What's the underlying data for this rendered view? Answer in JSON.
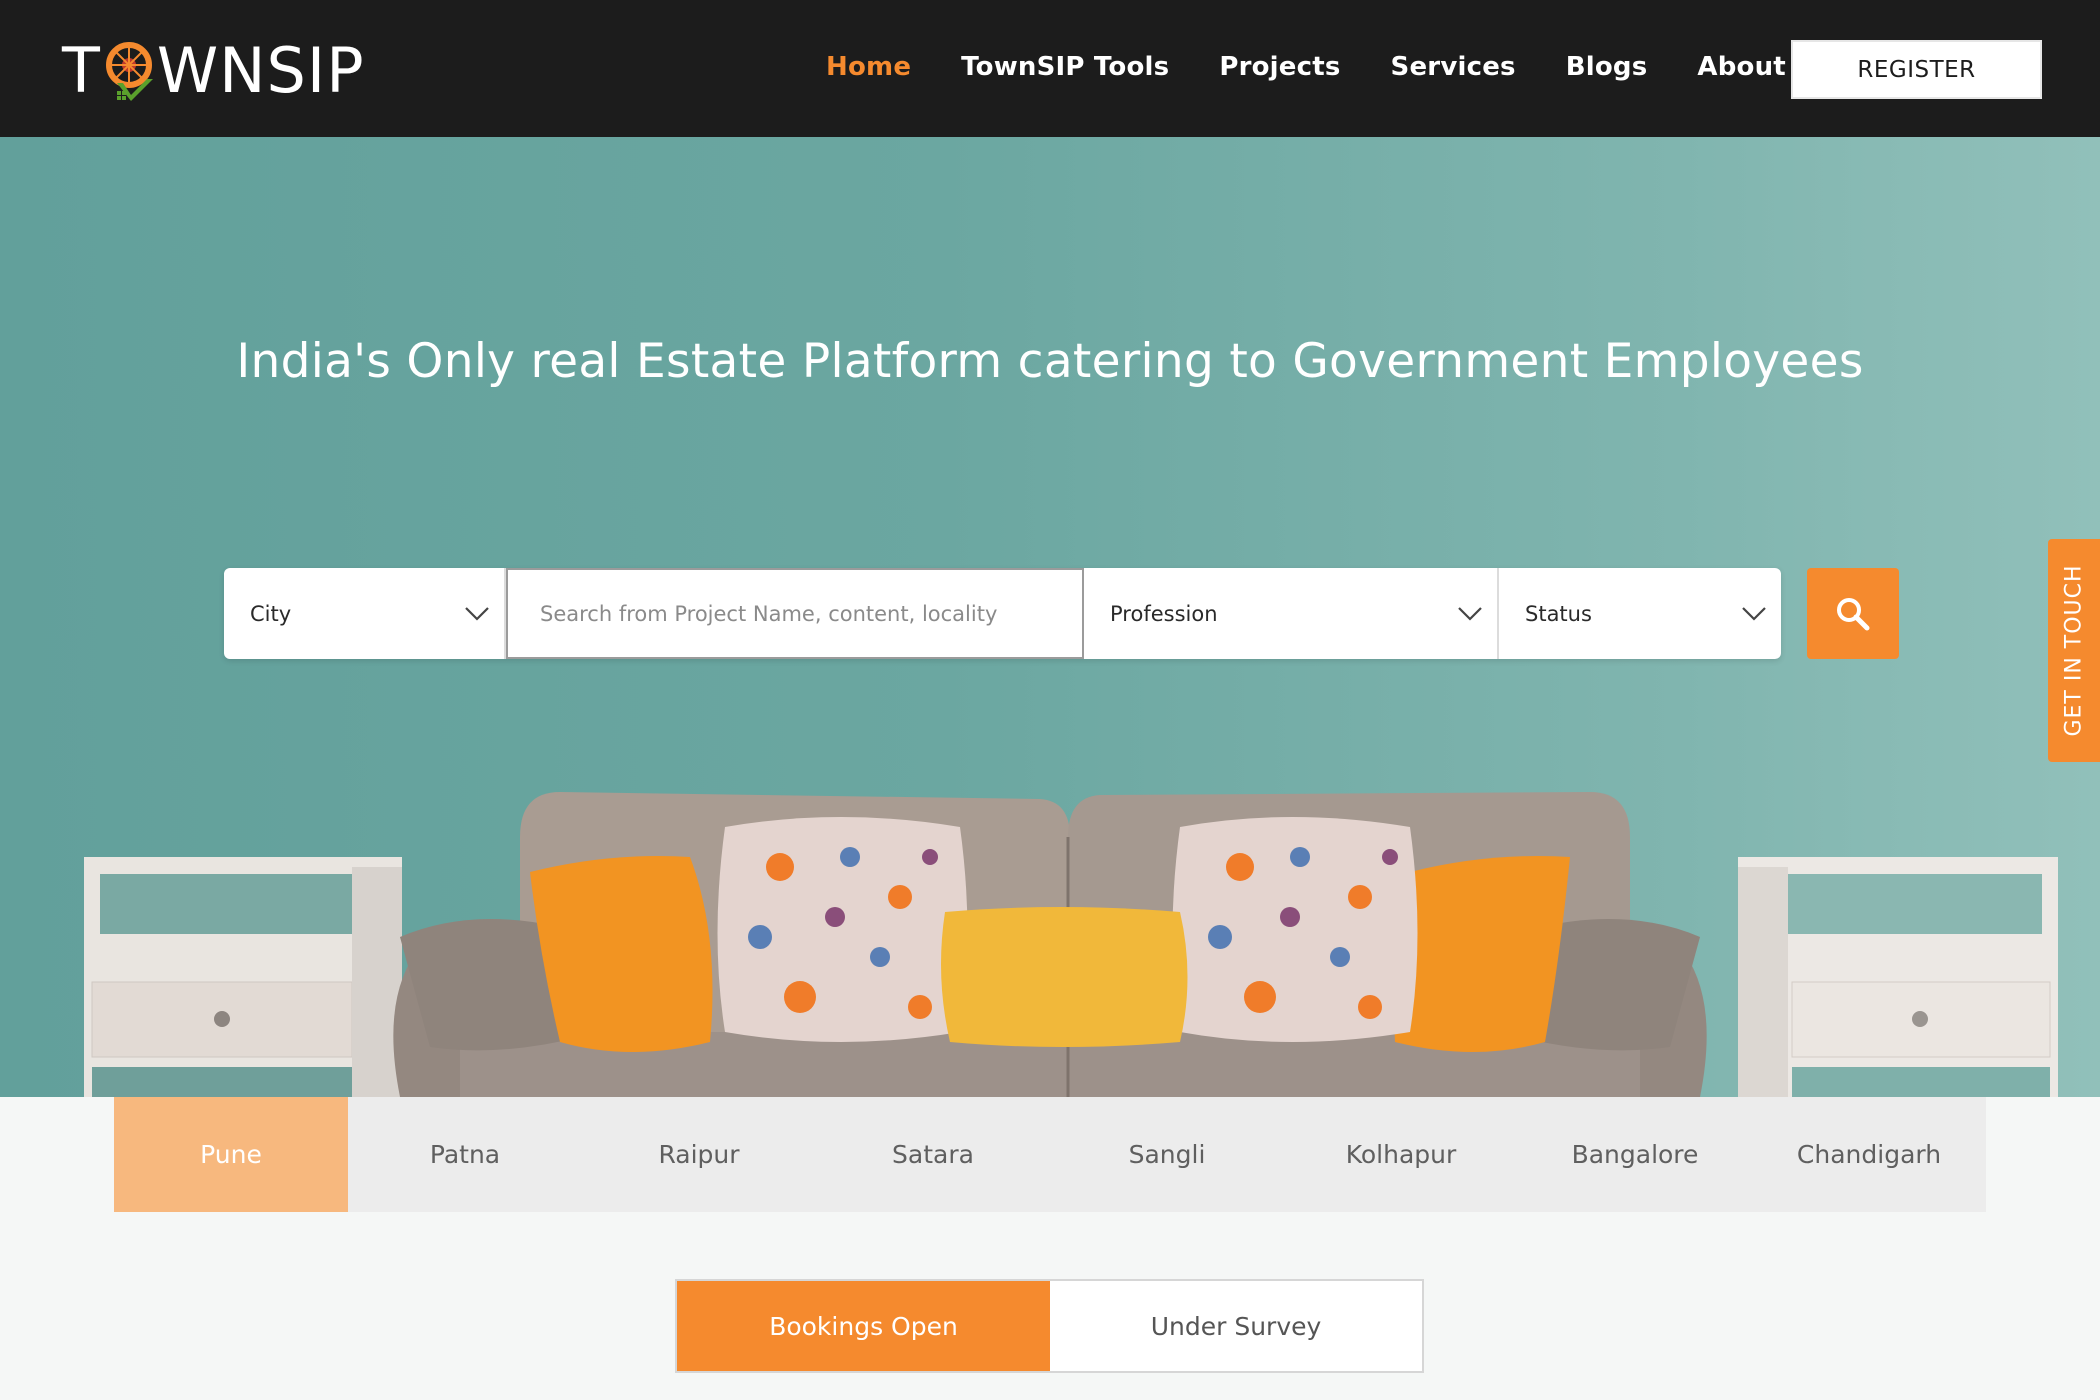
{
  "brand": {
    "logo_text_left": "T",
    "logo_text_right": "WNSIP"
  },
  "nav": {
    "items": [
      {
        "label": "Home",
        "active": true
      },
      {
        "label": "TownSIP Tools",
        "active": false
      },
      {
        "label": "Projects",
        "active": false
      },
      {
        "label": "Services",
        "active": false
      },
      {
        "label": "Blogs",
        "active": false
      },
      {
        "label": "About Us",
        "active": false
      }
    ],
    "register_label": "REGISTER"
  },
  "hero": {
    "headline": "India's Only real Estate Platform catering to Government Employees"
  },
  "search": {
    "city_label": "City",
    "query_placeholder": "Search from Project Name, content, locality",
    "profession_label": "Profession",
    "status_label": "Status",
    "search_icon": "search-icon"
  },
  "side_tab": {
    "label": "GET IN TOUCH"
  },
  "city_tabs": {
    "items": [
      {
        "label": "Pune",
        "active": true
      },
      {
        "label": "Patna",
        "active": false
      },
      {
        "label": "Raipur",
        "active": false
      },
      {
        "label": "Satara",
        "active": false
      },
      {
        "label": "Sangli",
        "active": false
      },
      {
        "label": "Kolhapur",
        "active": false
      },
      {
        "label": "Bangalore",
        "active": false
      },
      {
        "label": "Chandigarh",
        "active": false
      }
    ]
  },
  "status_tabs": {
    "bookings_open": "Bookings Open",
    "under_survey": "Under Survey"
  },
  "colors": {
    "accent": "#f58a2e",
    "header_bg": "#1c1c1c",
    "hero_bg": "#6ba7a1",
    "city_active": "#f7b87e"
  }
}
